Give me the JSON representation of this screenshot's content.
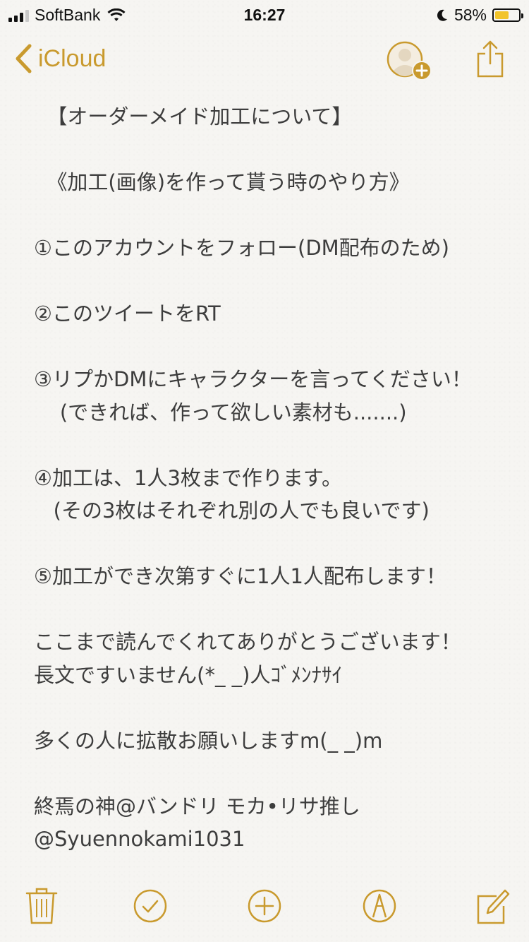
{
  "status_bar": {
    "carrier": "SoftBank",
    "time": "16:27",
    "battery_percent": "58%",
    "battery_level": 0.58
  },
  "nav": {
    "back_label": "iCloud",
    "icons": [
      "chevron-left-icon",
      "add-person-icon",
      "share-icon"
    ]
  },
  "note": {
    "lines": [
      "  【オーダーメイド加工について】",
      "",
      "  《加工(画像)を作って貰う時のやり方》",
      "",
      "①このアカウントをフォロー(DM配布のため)",
      "",
      "②このツイートをRT",
      "",
      "③リプかDMにキャラクターを言ってください！",
      "    (できれば、作って欲しい素材も.......)",
      "",
      "④加工は、1人3枚まで作ります。",
      "   (その3枚はそれぞれ別の人でも良いです)",
      "",
      "⑤加工ができ次第すぐに1人1人配布します！",
      "",
      "ここまで読んでくれてありがとうございます！",
      "長文ですいません(*_ _)人ｺﾞﾒﾝﾅｻｲ",
      "",
      "多くの人に拡散お願いしますm(_ _)m",
      "",
      "終焉の神@バンドリ モカ•リサ推し",
      "@Syuennokami1031"
    ]
  },
  "toolbar": {
    "icons": [
      "trash-icon",
      "checkmark-icon",
      "plus-icon",
      "sketch-icon",
      "compose-icon"
    ]
  },
  "colors": {
    "accent": "#c99a2e",
    "background": "#f6f5f2",
    "text": "#3d3d3d"
  }
}
